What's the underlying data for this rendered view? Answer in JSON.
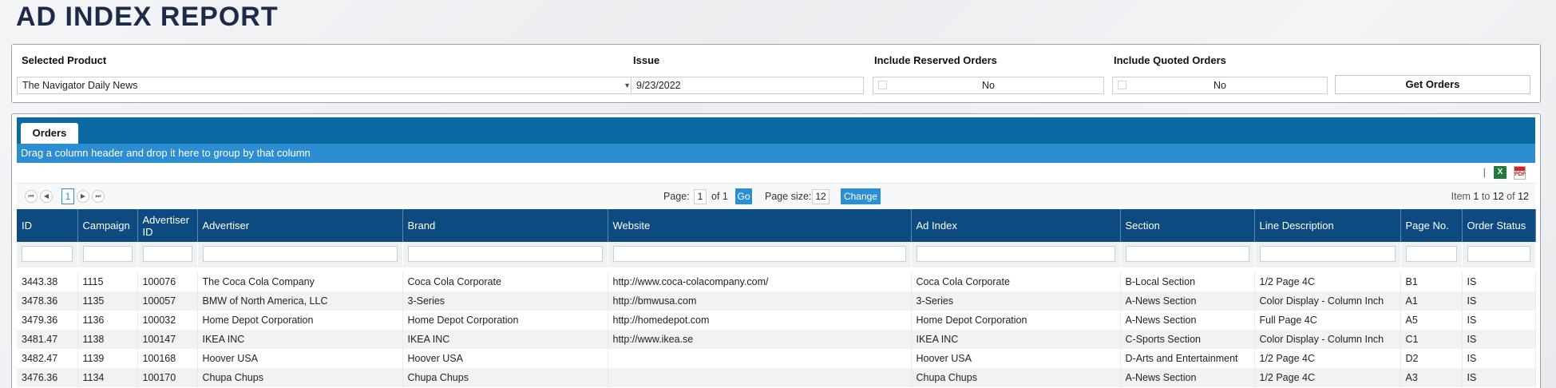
{
  "page_title": "AD INDEX REPORT",
  "filters": {
    "product_label": "Selected Product",
    "product_value": "The Navigator Daily News",
    "issue_label": "Issue",
    "issue_value": "9/23/2022",
    "reserved_label": "Include Reserved Orders",
    "reserved_value": "No",
    "quoted_label": "Include Quoted Orders",
    "quoted_value": "No",
    "get_orders_label": "Get Orders"
  },
  "orders": {
    "tab_label": "Orders",
    "group_hint": "Drag a column header and drop it here to group by that column",
    "toolbar": {
      "separator": "|",
      "excel_icon": "excel-icon",
      "pdf_icon": "pdf-icon"
    },
    "pager": {
      "first_icon": "⏮",
      "prev_icon": "◀",
      "next_icon": "▶",
      "last_icon": "⏭",
      "current_page": "1",
      "page_label": "Page:",
      "page_value": "1",
      "of_label": "of 1",
      "go_label": "Go",
      "size_label": "Page size:",
      "size_value": "12",
      "change_label": "Change",
      "info_prefix": "Item",
      "info_from": "1",
      "info_to_word": "to",
      "info_to": "12",
      "info_of_word": "of",
      "info_total": "12"
    },
    "columns": [
      "ID",
      "Campaign",
      "Advertiser ID",
      "Advertiser",
      "Brand",
      "Website",
      "Ad Index",
      "Section",
      "Line Description",
      "Page No.",
      "Order Status"
    ],
    "rows": [
      [
        "3443.38",
        "1115",
        "100076",
        "The Coca Cola Company",
        "Coca Cola Corporate",
        "http://www.coca-colacompany.com/",
        "Coca Cola Corporate",
        "B-Local Section",
        "1/2 Page 4C",
        "B1",
        "IS"
      ],
      [
        "3478.36",
        "1135",
        "100057",
        "BMW of North America, LLC",
        "3-Series",
        "http://bmwusa.com",
        "3-Series",
        "A-News Section",
        "Color Display - Column Inch",
        "A1",
        "IS"
      ],
      [
        "3479.36",
        "1136",
        "100032",
        "Home Depot Corporation",
        "Home Depot Corporation",
        "http://homedepot.com",
        "Home Depot Corporation",
        "A-News Section",
        "Full Page 4C",
        "A5",
        "IS"
      ],
      [
        "3481.47",
        "1138",
        "100147",
        "IKEA INC",
        "IKEA INC",
        "http://www.ikea.se",
        "IKEA INC",
        "C-Sports Section",
        "Color Display - Column Inch",
        "C1",
        "IS"
      ],
      [
        "3482.47",
        "1139",
        "100168",
        "Hoover USA",
        "Hoover USA",
        "",
        "Hoover USA",
        "D-Arts and Entertainment",
        "1/2 Page 4C",
        "D2",
        "IS"
      ],
      [
        "3476.36",
        "1134",
        "100170",
        "Chupa Chups",
        "Chupa Chups",
        "",
        "Chupa Chups",
        "A-News Section",
        "1/2 Page 4C",
        "A3",
        "IS"
      ]
    ]
  }
}
